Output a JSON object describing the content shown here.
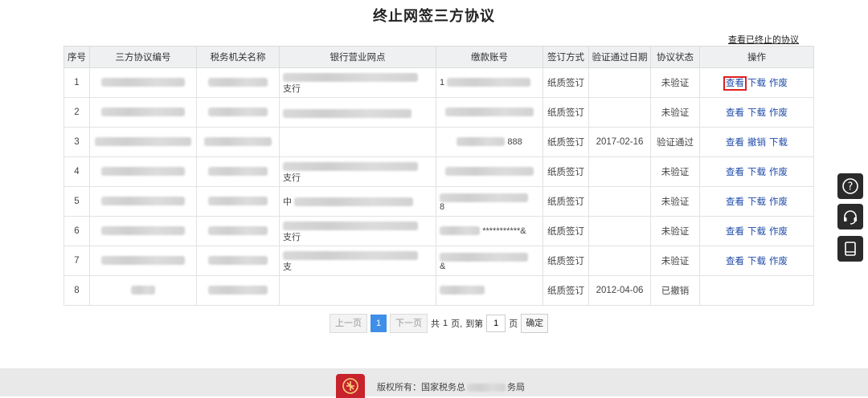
{
  "page": {
    "title": "终止网签三方协议",
    "view_terminated_link": "查看已终止的协议"
  },
  "table": {
    "headers": [
      "序号",
      "三方协议编号",
      "税务机关名称",
      "银行营业网点",
      "缴款账号",
      "签订方式",
      "验证通过日期",
      "协议状态",
      "操作"
    ],
    "rows": [
      {
        "no": "1",
        "bank_text": "支行",
        "account_text": "1",
        "method": "纸质签订",
        "date": "",
        "status": "未验证",
        "ops": [
          "查看",
          "下载",
          "作废"
        ]
      },
      {
        "no": "2",
        "bank_text": "",
        "account_text": "",
        "method": "纸质签订",
        "date": "",
        "status": "未验证",
        "ops": [
          "查看",
          "下载",
          "作废"
        ]
      },
      {
        "no": "3",
        "bank_text": "",
        "account_text": "888",
        "method": "纸质签订",
        "date": "2017-02-16",
        "status": "验证通过",
        "ops": [
          "查看",
          "撤销",
          "下载"
        ]
      },
      {
        "no": "4",
        "bank_text": "支行",
        "account_text": "",
        "method": "纸质签订",
        "date": "",
        "status": "未验证",
        "ops": [
          "查看",
          "下载",
          "作废"
        ]
      },
      {
        "no": "5",
        "bank_text": "中",
        "account_text": "8",
        "method": "纸质签订",
        "date": "",
        "status": "未验证",
        "ops": [
          "查看",
          "下载",
          "作废"
        ]
      },
      {
        "no": "6",
        "bank_text": "支行",
        "account_text": "***********&",
        "method": "纸质签订",
        "date": "",
        "status": "未验证",
        "ops": [
          "查看",
          "下载",
          "作废"
        ]
      },
      {
        "no": "7",
        "bank_text": "支",
        "account_text": "&",
        "method": "纸质签订",
        "date": "",
        "status": "未验证",
        "ops": [
          "查看",
          "下载",
          "作废"
        ]
      },
      {
        "no": "8",
        "bank_text": "",
        "account_text": "",
        "method": "纸质签订",
        "date": "2012-04-06",
        "status": "已撤销",
        "ops": []
      }
    ]
  },
  "pager": {
    "prev": "上一页",
    "current": "1",
    "next": "下一页",
    "total_prefix": "共",
    "total_pages": "1",
    "total_suffix": "页,",
    "goto_prefix": "到第",
    "goto_value": "1",
    "goto_suffix": "页",
    "confirm": "确定"
  },
  "sidebar": {
    "icons": [
      "help-icon",
      "headset-icon",
      "book-icon"
    ]
  },
  "footer": {
    "copyright_prefix": "版权所有：国家税务总",
    "copyright_suffix": "务局"
  },
  "colors": {
    "link": "#1f4ba8",
    "highlight": "#e02020",
    "pager_active": "#3e8fe8",
    "footer_bg": "#e9e9ea"
  }
}
